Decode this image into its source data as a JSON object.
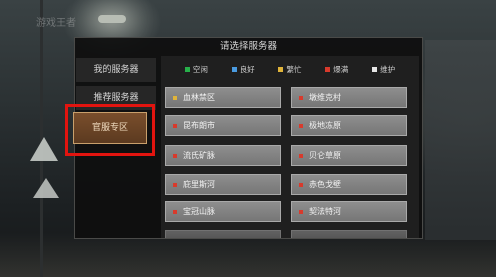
{
  "watermark": "游戏王者",
  "dialog": {
    "title": "请选择服务器"
  },
  "sidebar": {
    "my_servers": "我的服务器",
    "recommended": "推荐服务器",
    "official": "官服专区"
  },
  "legend": [
    {
      "label": "空闲",
      "color": "#27b04a"
    },
    {
      "label": "良好",
      "color": "#4a9be0"
    },
    {
      "label": "繁忙",
      "color": "#e0b43a"
    },
    {
      "label": "爆满",
      "color": "#d83a2c"
    },
    {
      "label": "维护",
      "color": "#e6e6e6"
    }
  ],
  "servers": [
    {
      "name": "血林禁区",
      "status_color": "#e0b43a"
    },
    {
      "name": "墩维克村",
      "status_color": "#d83a2c"
    },
    {
      "name": "昆布朗市",
      "status_color": "#d83a2c"
    },
    {
      "name": "极地冻原",
      "status_color": "#d83a2c"
    },
    {
      "name": "流氏矿脉",
      "status_color": "#d83a2c"
    },
    {
      "name": "贝仑草原",
      "status_color": "#d83a2c"
    },
    {
      "name": "庇里斯河",
      "status_color": "#d83a2c"
    },
    {
      "name": "赤色戈壁",
      "status_color": "#d83a2c"
    },
    {
      "name": "宝冠山脉",
      "status_color": "#d83a2c"
    },
    {
      "name": "契法特河",
      "status_color": "#d83a2c"
    }
  ]
}
